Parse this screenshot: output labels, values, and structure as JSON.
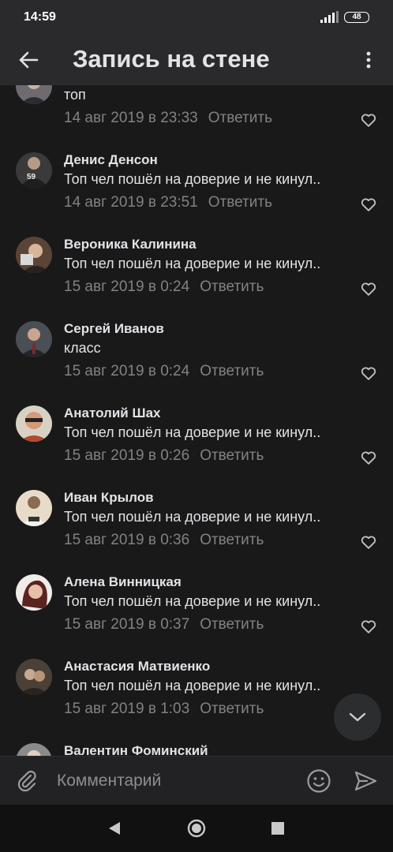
{
  "status_bar": {
    "time": "14:59",
    "battery": "48"
  },
  "header": {
    "title": "Запись на стене",
    "back_icon": "arrow-back-icon",
    "menu_icon": "more-vertical-icon"
  },
  "comments": [
    {
      "name": "",
      "text": "топ",
      "date": "14 авг 2019 в 23:33",
      "reply": "Ответить",
      "avatar_color": "#6e6a70"
    },
    {
      "name": "Денис Денсон",
      "text": "Топ чел пошёл на доверие и не кинул..",
      "date": "14 авг 2019 в 23:51",
      "reply": "Ответить",
      "avatar_color": "#3a3a3a"
    },
    {
      "name": "Вероника Калинина",
      "text": "Топ чел пошёл на доверие и не кинул..",
      "date": "15 авг 2019 в 0:24",
      "reply": "Ответить",
      "avatar_color": "#5a4436"
    },
    {
      "name": "Сергей Иванов",
      "text": "класс",
      "date": "15 авг 2019 в 0:24",
      "reply": "Ответить",
      "avatar_color": "#4a4e55"
    },
    {
      "name": "Анатолий Шах",
      "text": "Топ чел пошёл на доверие и не кинул..",
      "date": "15 авг 2019 в 0:26",
      "reply": "Ответить",
      "avatar_color": "#b08a6a"
    },
    {
      "name": "Иван Крылов",
      "text": "Топ чел пошёл на доверие и не кинул..",
      "date": "15 авг 2019 в 0:36",
      "reply": "Ответить",
      "avatar_color": "#6a5a4a"
    },
    {
      "name": "Алена Винницкая",
      "text": "Топ чел пошёл на доверие и не кинул..",
      "date": "15 авг 2019 в 0:37",
      "reply": "Ответить",
      "avatar_color": "#7a3a36"
    },
    {
      "name": "Анастасия Матвиенко",
      "text": "Топ чел пошёл на доверие и не кинул..",
      "date": "15 авг 2019 в 1:03",
      "reply": "Ответить",
      "avatar_color": "#4a4038"
    },
    {
      "name": "Валентин Фоминский",
      "text": "",
      "date": "",
      "reply": "",
      "avatar_color": "#8a8a8a"
    }
  ],
  "composer": {
    "placeholder": "Комментарий"
  },
  "colors": {
    "background": "#19191a",
    "bar": "#2a2a2c",
    "secondary_text": "#828282",
    "primary_text": "#e1e3e6"
  }
}
